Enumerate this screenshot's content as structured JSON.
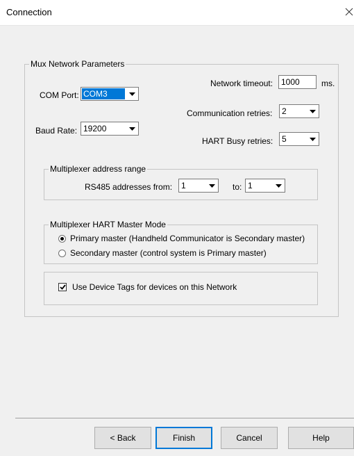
{
  "window": {
    "title": "Connection"
  },
  "mux": {
    "legend": "Mux Network Parameters",
    "com_port": {
      "label": "COM Port:",
      "value": "COM3"
    },
    "baud_rate": {
      "label": "Baud Rate:",
      "value": "19200"
    },
    "network_timeout": {
      "label": "Network timeout:",
      "value": "1000",
      "unit": "ms."
    },
    "communication_retries": {
      "label": "Communication retries:",
      "value": "2"
    },
    "hart_busy_retries": {
      "label": "HART Busy retries:",
      "value": "5"
    }
  },
  "address_range": {
    "legend": "Multiplexer address range",
    "from_label": "RS485 addresses from:",
    "from_value": "1",
    "to_label": "to:",
    "to_value": "1"
  },
  "master_mode": {
    "legend": "Multiplexer HART Master Mode",
    "options": [
      {
        "label": "Primary master (Handheld Communicator is Secondary master)",
        "selected": true
      },
      {
        "label": "Secondary master (control system is Primary master)",
        "selected": false
      }
    ]
  },
  "device_tags": {
    "label": "Use Device Tags for devices on this Network",
    "checked": true
  },
  "buttons": {
    "back": "< Back",
    "finish": "Finish",
    "cancel": "Cancel",
    "help": "Help"
  }
}
